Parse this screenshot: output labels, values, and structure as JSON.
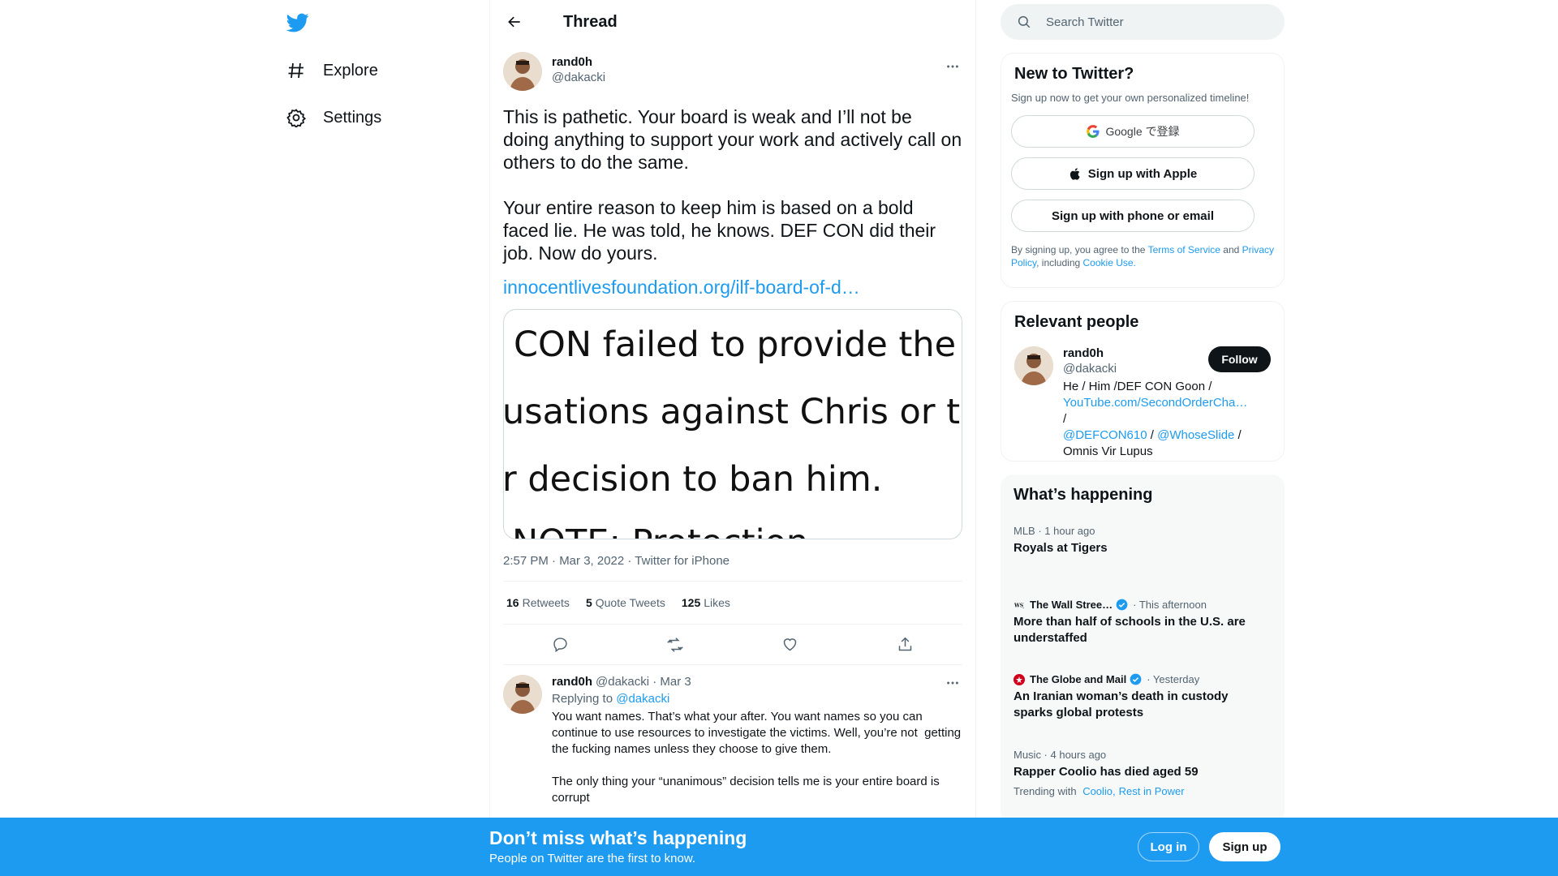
{
  "nav": {
    "logo": "twitter-bird-icon",
    "items": [
      {
        "label": "Explore",
        "icon": "hashtag-icon"
      },
      {
        "label": "Settings",
        "icon": "gear-icon"
      }
    ]
  },
  "header": {
    "title": "Thread"
  },
  "tweet": {
    "author_name": "rand0h",
    "author_handle": "@dakacki",
    "text": "This is pathetic. Your board is weak and I’ll not be doing anything to support your work and actively call on others to do the same.\n\nYour entire reason to keep him is based on a bold faced lie. He was told, he knows. DEF CON did their job. Now do yours.",
    "link": "innocentlivesfoundation.org/ilf-board-of-d…",
    "media_lines": [
      "CON failed to provide the",
      "usations against Chris or to e",
      "r decision to ban him.",
      "NOTE: Protection"
    ],
    "meta": "2:57 PM · Mar 3, 2022 · Twitter for iPhone",
    "stats": {
      "retweets": "16",
      "retweets_label": "Retweets",
      "quotes": "5",
      "quotes_label": "Quote Tweets",
      "likes": "125",
      "likes_label": "Likes"
    }
  },
  "reply": {
    "author_name": "rand0h",
    "meta": "@dakacki · Mar 3",
    "replying_label": "Replying to",
    "replying_to": "@dakacki",
    "text": "You want names. That’s what your after. You want names so you can continue to use resources to investigate the victims. Well, you’re not  getting the fucking names unless they choose to give them.\n\nThe only thing your “unanimous” decision tells me is your entire board is corrupt"
  },
  "search": {
    "placeholder": "Search Twitter"
  },
  "new_to_twitter": {
    "title": "New to Twitter?",
    "subtitle": "Sign up now to get your own personalized timeline!",
    "google_label": "Google で登録",
    "apple_label": "Sign up with Apple",
    "phone_label": "Sign up with phone or email",
    "terms_prefix": "By signing up, you agree to the",
    "terms_link": "Terms of Service",
    "terms_and": "and",
    "privacy_link": "Privacy Policy",
    "including": ", including",
    "cookie_link": "Cookie Use."
  },
  "relevant_people": {
    "title": "Relevant people",
    "name": "rand0h",
    "handle": "@dakacki",
    "follow_label": "Follow",
    "bio_1": "He / Him /DEF CON Goon /",
    "bio_link1": "YouTube.com/SecondOrderCha…",
    "bio_sep1": " /",
    "bio_link2": "@DEFCON610",
    "bio_sep2": " / ",
    "bio_link3": "@WhoseSlide",
    "bio_sep3": " /",
    "bio_2": "Omnis Vir Lupus"
  },
  "happening": {
    "title": "What’s happening",
    "trends": [
      {
        "meta": "MLB · 1 hour ago",
        "title": "Royals at Tigers"
      },
      {
        "source": "The Wall Stree…",
        "time": "· This afternoon",
        "title": "More than half of schools in the U.S. are understaffed"
      },
      {
        "source": "The Globe and Mail",
        "time": "· Yesterday",
        "title": "An Iranian woman’s death in custody sparks global protests"
      },
      {
        "meta": "Music · 4 hours ago",
        "title": "Rapper Coolio has died aged 59",
        "trending_label": "Trending with",
        "with1": "Coolio,",
        "with2": "Rest in Power"
      }
    ]
  },
  "bottom_bar": {
    "title": "Don’t miss what’s happening",
    "subtitle": "People on Twitter are the first to know.",
    "login_label": "Log in",
    "signup_label": "Sign up"
  },
  "colors": {
    "accent": "#1d9bf0",
    "text": "#0f1419",
    "muted": "#536471"
  }
}
